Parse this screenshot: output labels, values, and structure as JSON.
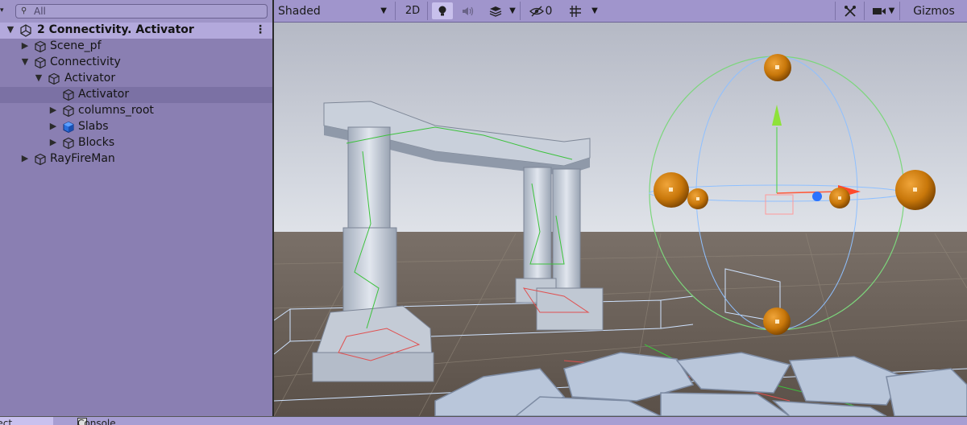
{
  "hierarchy": {
    "search_placeholder": "All",
    "scene_name": "2 Connectivity. Activator",
    "items": [
      {
        "label": "Scene_pf"
      },
      {
        "label": "Connectivity"
      },
      {
        "label": "Activator"
      },
      {
        "label": "Activator"
      },
      {
        "label": "columns_root"
      },
      {
        "label": "Slabs"
      },
      {
        "label": "Blocks"
      },
      {
        "label": "RayFireMan"
      }
    ]
  },
  "scene_toolbar": {
    "shading_mode": "Shaded",
    "mode_2d": "2D",
    "hidden_count": "0",
    "gizmos_label": "Gizmos"
  },
  "bottom_tabs": {
    "project": "Project",
    "console": "Console"
  },
  "colors": {
    "editor_tint": "#8a7fb2",
    "selection": "#7b71a4",
    "sky": "#c9d1dc",
    "ground": "#6c6258",
    "gizmo_handle": "#c8770a"
  }
}
